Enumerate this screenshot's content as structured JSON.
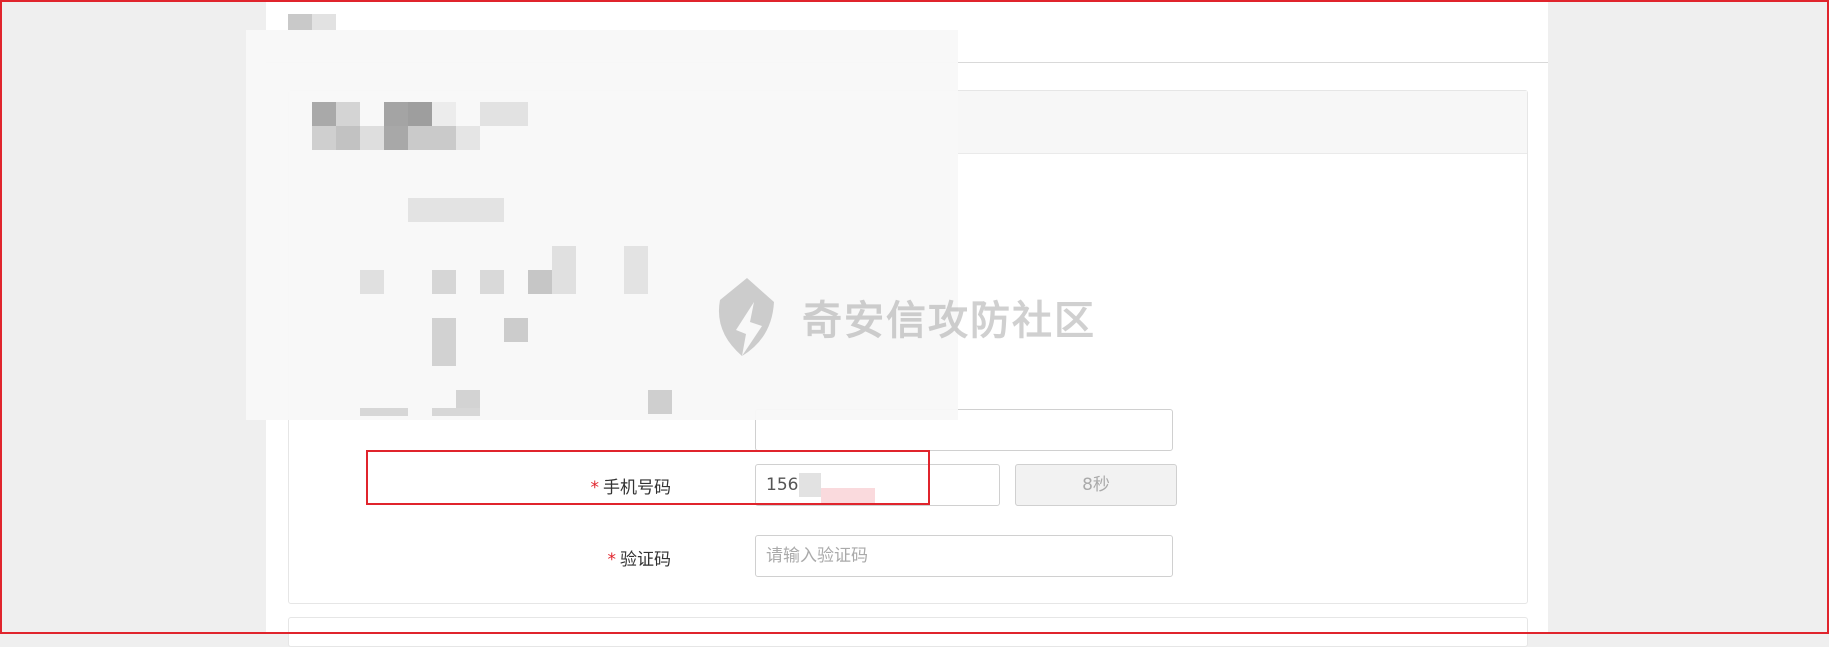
{
  "form": {
    "phone": {
      "required_mark": "*",
      "label": "手机号码",
      "value": "156",
      "countdown_label": "8秒"
    },
    "code": {
      "required_mark": "*",
      "label": "验证码",
      "placeholder": "请输入验证码"
    }
  },
  "watermark": {
    "text": "奇安信攻防社区"
  },
  "colors": {
    "accent_red": "#e0242c",
    "border": "#d0d0d0"
  }
}
